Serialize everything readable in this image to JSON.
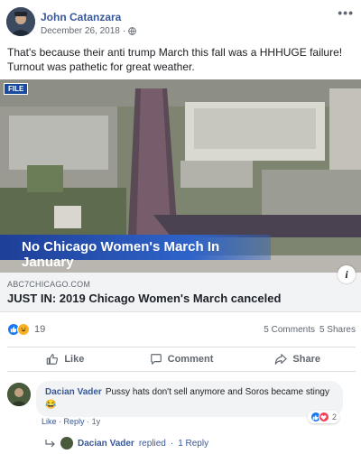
{
  "post": {
    "author": "John Catanzara",
    "date": "December 26, 2018",
    "separator": "·",
    "more_label": "•••",
    "text": "That's because their anti trump March this fall was a HHHUGE failure! Turnout was pathetic for great weather."
  },
  "photo": {
    "file_tag": "FILE",
    "banner": "No Chicago Women's March In January"
  },
  "link": {
    "domain": "ABC7CHICAGO.COM",
    "title": "JUST IN: 2019 Chicago Women's March canceled",
    "info_glyph": "i"
  },
  "stats": {
    "reaction_count": "19",
    "comments": "5 Comments",
    "shares": "5 Shares"
  },
  "actions": {
    "like": "Like",
    "comment": "Comment",
    "share": "Share"
  },
  "comment": {
    "author": "Dacian Vader",
    "text": "Pussy hats don't sell anymore and Soros became stingy",
    "emoji": "😂",
    "like": "Like",
    "reply": "Reply",
    "dot": "·",
    "age": "1y",
    "reaction_count": "2"
  },
  "reply_summary": {
    "name": "Dacian Vader",
    "replied": "replied",
    "dot": "·",
    "count": "1 Reply"
  },
  "colors": {
    "link_blue": "#385898",
    "like_blue": "#1877f2",
    "banner_blue": "#2f63c9"
  }
}
